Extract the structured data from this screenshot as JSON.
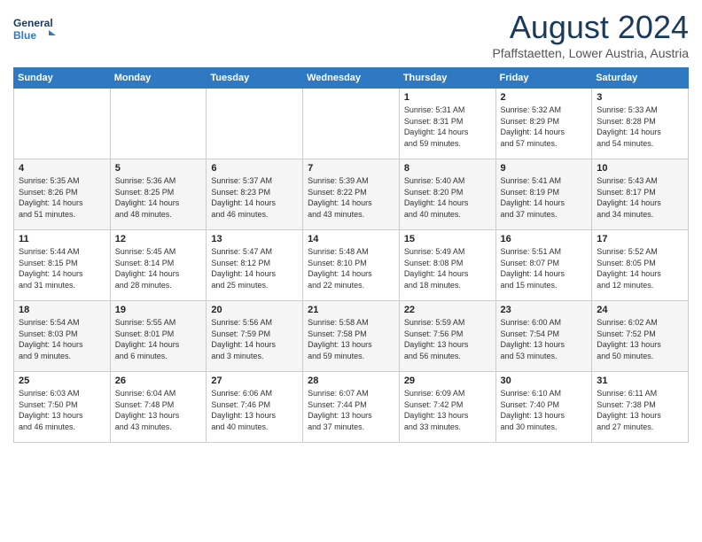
{
  "header": {
    "logo_line1": "General",
    "logo_line2": "Blue",
    "month": "August 2024",
    "location": "Pfaffstaetten, Lower Austria, Austria"
  },
  "weekdays": [
    "Sunday",
    "Monday",
    "Tuesday",
    "Wednesday",
    "Thursday",
    "Friday",
    "Saturday"
  ],
  "weeks": [
    [
      {
        "day": "",
        "info": ""
      },
      {
        "day": "",
        "info": ""
      },
      {
        "day": "",
        "info": ""
      },
      {
        "day": "",
        "info": ""
      },
      {
        "day": "1",
        "info": "Sunrise: 5:31 AM\nSunset: 8:31 PM\nDaylight: 14 hours\nand 59 minutes."
      },
      {
        "day": "2",
        "info": "Sunrise: 5:32 AM\nSunset: 8:29 PM\nDaylight: 14 hours\nand 57 minutes."
      },
      {
        "day": "3",
        "info": "Sunrise: 5:33 AM\nSunset: 8:28 PM\nDaylight: 14 hours\nand 54 minutes."
      }
    ],
    [
      {
        "day": "4",
        "info": "Sunrise: 5:35 AM\nSunset: 8:26 PM\nDaylight: 14 hours\nand 51 minutes."
      },
      {
        "day": "5",
        "info": "Sunrise: 5:36 AM\nSunset: 8:25 PM\nDaylight: 14 hours\nand 48 minutes."
      },
      {
        "day": "6",
        "info": "Sunrise: 5:37 AM\nSunset: 8:23 PM\nDaylight: 14 hours\nand 46 minutes."
      },
      {
        "day": "7",
        "info": "Sunrise: 5:39 AM\nSunset: 8:22 PM\nDaylight: 14 hours\nand 43 minutes."
      },
      {
        "day": "8",
        "info": "Sunrise: 5:40 AM\nSunset: 8:20 PM\nDaylight: 14 hours\nand 40 minutes."
      },
      {
        "day": "9",
        "info": "Sunrise: 5:41 AM\nSunset: 8:19 PM\nDaylight: 14 hours\nand 37 minutes."
      },
      {
        "day": "10",
        "info": "Sunrise: 5:43 AM\nSunset: 8:17 PM\nDaylight: 14 hours\nand 34 minutes."
      }
    ],
    [
      {
        "day": "11",
        "info": "Sunrise: 5:44 AM\nSunset: 8:15 PM\nDaylight: 14 hours\nand 31 minutes."
      },
      {
        "day": "12",
        "info": "Sunrise: 5:45 AM\nSunset: 8:14 PM\nDaylight: 14 hours\nand 28 minutes."
      },
      {
        "day": "13",
        "info": "Sunrise: 5:47 AM\nSunset: 8:12 PM\nDaylight: 14 hours\nand 25 minutes."
      },
      {
        "day": "14",
        "info": "Sunrise: 5:48 AM\nSunset: 8:10 PM\nDaylight: 14 hours\nand 22 minutes."
      },
      {
        "day": "15",
        "info": "Sunrise: 5:49 AM\nSunset: 8:08 PM\nDaylight: 14 hours\nand 18 minutes."
      },
      {
        "day": "16",
        "info": "Sunrise: 5:51 AM\nSunset: 8:07 PM\nDaylight: 14 hours\nand 15 minutes."
      },
      {
        "day": "17",
        "info": "Sunrise: 5:52 AM\nSunset: 8:05 PM\nDaylight: 14 hours\nand 12 minutes."
      }
    ],
    [
      {
        "day": "18",
        "info": "Sunrise: 5:54 AM\nSunset: 8:03 PM\nDaylight: 14 hours\nand 9 minutes."
      },
      {
        "day": "19",
        "info": "Sunrise: 5:55 AM\nSunset: 8:01 PM\nDaylight: 14 hours\nand 6 minutes."
      },
      {
        "day": "20",
        "info": "Sunrise: 5:56 AM\nSunset: 7:59 PM\nDaylight: 14 hours\nand 3 minutes."
      },
      {
        "day": "21",
        "info": "Sunrise: 5:58 AM\nSunset: 7:58 PM\nDaylight: 13 hours\nand 59 minutes."
      },
      {
        "day": "22",
        "info": "Sunrise: 5:59 AM\nSunset: 7:56 PM\nDaylight: 13 hours\nand 56 minutes."
      },
      {
        "day": "23",
        "info": "Sunrise: 6:00 AM\nSunset: 7:54 PM\nDaylight: 13 hours\nand 53 minutes."
      },
      {
        "day": "24",
        "info": "Sunrise: 6:02 AM\nSunset: 7:52 PM\nDaylight: 13 hours\nand 50 minutes."
      }
    ],
    [
      {
        "day": "25",
        "info": "Sunrise: 6:03 AM\nSunset: 7:50 PM\nDaylight: 13 hours\nand 46 minutes."
      },
      {
        "day": "26",
        "info": "Sunrise: 6:04 AM\nSunset: 7:48 PM\nDaylight: 13 hours\nand 43 minutes."
      },
      {
        "day": "27",
        "info": "Sunrise: 6:06 AM\nSunset: 7:46 PM\nDaylight: 13 hours\nand 40 minutes."
      },
      {
        "day": "28",
        "info": "Sunrise: 6:07 AM\nSunset: 7:44 PM\nDaylight: 13 hours\nand 37 minutes."
      },
      {
        "day": "29",
        "info": "Sunrise: 6:09 AM\nSunset: 7:42 PM\nDaylight: 13 hours\nand 33 minutes."
      },
      {
        "day": "30",
        "info": "Sunrise: 6:10 AM\nSunset: 7:40 PM\nDaylight: 13 hours\nand 30 minutes."
      },
      {
        "day": "31",
        "info": "Sunrise: 6:11 AM\nSunset: 7:38 PM\nDaylight: 13 hours\nand 27 minutes."
      }
    ]
  ]
}
